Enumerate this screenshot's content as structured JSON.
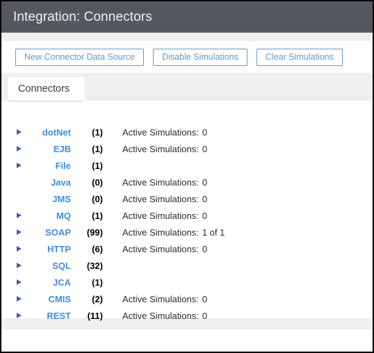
{
  "window": {
    "title": "Integration: Connectors",
    "title_bar_color": "#54585e",
    "accent_color": "#5b9bd5",
    "link_color": "#3d8bf2"
  },
  "toolbar": {
    "buttons": [
      {
        "label": "New Connector Data Source",
        "name": "new-connector-data-source-button"
      },
      {
        "label": "Disable Simulations",
        "name": "disable-simulations-button"
      },
      {
        "label": "Clear Simulations",
        "name": "clear-simulations-button"
      }
    ]
  },
  "tabs": [
    {
      "label": "Connectors",
      "active": true
    }
  ],
  "connectors": {
    "sim_label": "Active Simulations:",
    "rows": [
      {
        "name": "dotNet",
        "count": "(1)",
        "expandable": true,
        "has_sim": true,
        "sim_label": "Active Simulations:",
        "sim_value": "0"
      },
      {
        "name": "EJB",
        "count": "(1)",
        "expandable": true,
        "has_sim": true,
        "sim_label": "Active Simulations:",
        "sim_value": "0"
      },
      {
        "name": "File",
        "count": "(1)",
        "expandable": true,
        "has_sim": false,
        "sim_label": "",
        "sim_value": ""
      },
      {
        "name": "Java",
        "count": "(0)",
        "expandable": false,
        "has_sim": true,
        "sim_label": "Active Simulations:",
        "sim_value": "0"
      },
      {
        "name": "JMS",
        "count": "(0)",
        "expandable": false,
        "has_sim": true,
        "sim_label": "Active Simulations:",
        "sim_value": "0"
      },
      {
        "name": "MQ",
        "count": "(1)",
        "expandable": true,
        "has_sim": true,
        "sim_label": "Active Simulations:",
        "sim_value": "0"
      },
      {
        "name": "SOAP",
        "count": "(99)",
        "expandable": true,
        "has_sim": true,
        "sim_label": "Active Simulations:",
        "sim_value": "1 of 1"
      },
      {
        "name": "HTTP",
        "count": "(6)",
        "expandable": true,
        "has_sim": true,
        "sim_label": "Active Simulations:",
        "sim_value": "0"
      },
      {
        "name": "SQL",
        "count": "(32)",
        "expandable": true,
        "has_sim": false,
        "sim_label": "",
        "sim_value": ""
      },
      {
        "name": "JCA",
        "count": "(1)",
        "expandable": true,
        "has_sim": false,
        "sim_label": "",
        "sim_value": ""
      },
      {
        "name": "CMIS",
        "count": "(2)",
        "expandable": true,
        "has_sim": true,
        "sim_label": "Active Simulations:",
        "sim_value": "0"
      },
      {
        "name": "REST",
        "count": "(11)",
        "expandable": true,
        "has_sim": true,
        "sim_label": "Active Simulations:",
        "sim_value": "0"
      }
    ]
  }
}
